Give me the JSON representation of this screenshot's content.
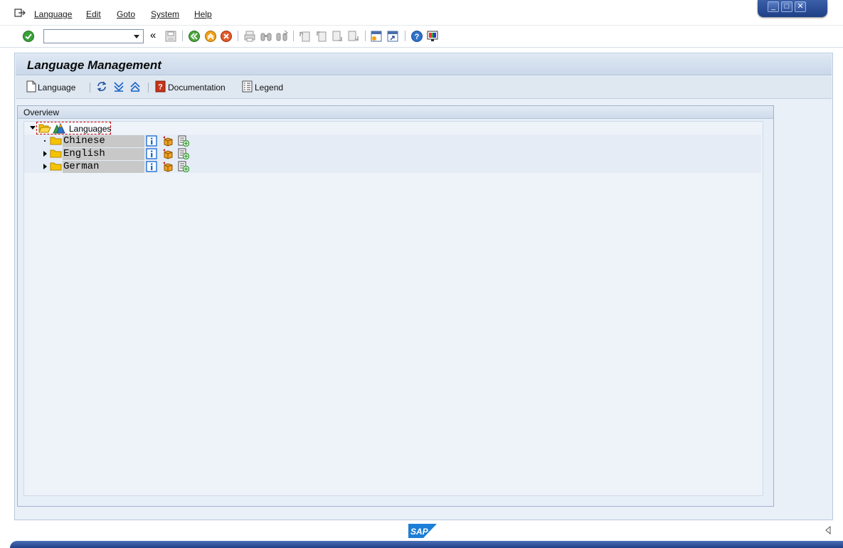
{
  "menu": {
    "items": [
      {
        "label": "Language"
      },
      {
        "label": "Edit"
      },
      {
        "label": "Goto"
      },
      {
        "label": "System"
      },
      {
        "label": "Help"
      }
    ]
  },
  "toolbar": {
    "command_field": {
      "value": "",
      "placeholder": ""
    },
    "back_arrows": "«"
  },
  "page": {
    "title": "Language Management"
  },
  "app_toolbar": {
    "language_label": "Language",
    "documentation_label": "Documentation",
    "legend_label": "Legend"
  },
  "overview": {
    "label": "Overview",
    "root": {
      "label": "Languages",
      "expanded": true
    },
    "nodes": [
      {
        "label": "Chinese",
        "expander": "none"
      },
      {
        "label": "English",
        "expander": "collapsed"
      },
      {
        "label": "German",
        "expander": "collapsed"
      }
    ]
  },
  "status": {
    "logo_text": "SAP"
  },
  "colors": {
    "accent_blue": "#2d4f9a",
    "frame_bg": "#eaf0f8",
    "info_icon": "#1f6fd1",
    "folder_yellow": "#f5c400",
    "ok_green": "#3aa13a"
  },
  "icons": {
    "info": "info-icon",
    "transport": "transport-icon",
    "add_entry": "add-entry-icon"
  }
}
